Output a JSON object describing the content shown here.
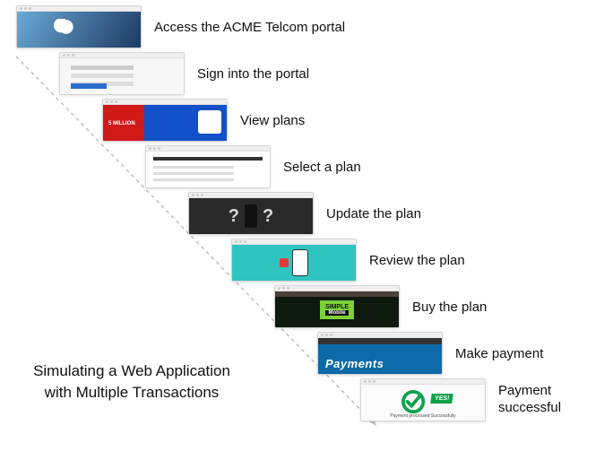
{
  "steps": [
    {
      "label": "Access the ACME Telcom portal"
    },
    {
      "label": "Sign into the portal"
    },
    {
      "label": "View plans"
    },
    {
      "label": "Select a plan"
    },
    {
      "label": "Update the plan"
    },
    {
      "label": "Review the plan"
    },
    {
      "label": "Buy the plan"
    },
    {
      "label": "Make payment"
    },
    {
      "label": "Payment successful"
    }
  ],
  "thumb_text": {
    "five_million": "5 MILLION",
    "simple": "SIMPLE",
    "mobile": "Mobile",
    "payments": "Payments",
    "yes": "YES!",
    "success_msg": "Payment processed Successfully"
  },
  "caption_line1": "Simulating a Web Application",
  "caption_line2": "with Multiple Transactions"
}
